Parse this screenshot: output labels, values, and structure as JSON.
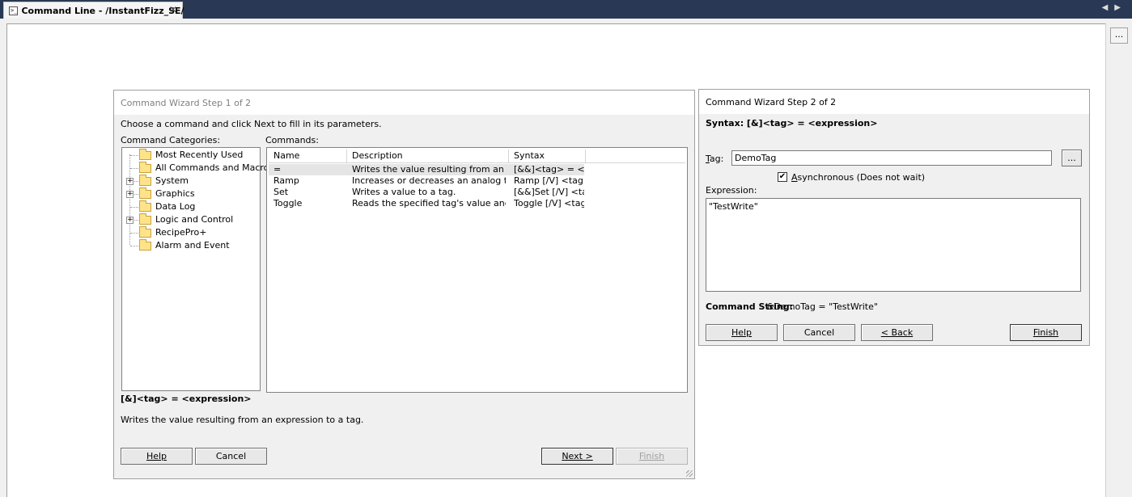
{
  "tab": {
    "title": "Command Line - /InstantFizz_SE/",
    "close": "✕"
  },
  "nav": {
    "prev": "◀",
    "next": "▶"
  },
  "side_button": {
    "label": "..."
  },
  "wizard1": {
    "title": "Command Wizard Step 1 of 2",
    "instruction": "Choose a command and click Next to fill in its parameters.",
    "categories_label": "Command Categories:",
    "commands_label": "Commands:",
    "categories": [
      {
        "label": "Most Recently Used",
        "expandable": false
      },
      {
        "label": "All Commands and Macros",
        "expandable": false
      },
      {
        "label": "System",
        "expandable": true
      },
      {
        "label": "Graphics",
        "expandable": true
      },
      {
        "label": "Data Log",
        "expandable": false
      },
      {
        "label": "Logic and Control",
        "expandable": true
      },
      {
        "label": "RecipePro+",
        "expandable": false
      },
      {
        "label": "Alarm and Event",
        "expandable": false
      }
    ],
    "columns": {
      "name": "Name",
      "description": "Description",
      "syntax": "Syntax"
    },
    "commands": [
      {
        "name": "=",
        "description": "Writes the value resulting from an exp...",
        "syntax": "[&&]<tag> = <ex...",
        "selected": true
      },
      {
        "name": "Ramp",
        "description": "Increases or decreases an analog tag...",
        "syntax": "Ramp [/V] <tag...",
        "selected": false
      },
      {
        "name": "Set",
        "description": "Writes a value to a tag.",
        "syntax": "[&&]Set [/V] <ta...",
        "selected": false
      },
      {
        "name": "Toggle",
        "description": "Reads the specified tag's value and ...",
        "syntax": "Toggle [/V] <tag>",
        "selected": false
      }
    ],
    "syntax_display": "[&]<tag> = <expression>",
    "description_display": "Writes the value resulting from an expression to a tag.",
    "buttons": {
      "help": "Help",
      "cancel": "Cancel",
      "next": "Next >",
      "finish": "Finish"
    }
  },
  "wizard2": {
    "title": "Command Wizard Step 2 of 2",
    "syntax": "Syntax: [&]<tag> = <expression>",
    "tag_label": "Tag:",
    "tag_value": "DemoTag",
    "browse": "...",
    "async_label": "Asynchronous (Does not wait)",
    "async_checked": true,
    "check_glyph": "✔",
    "expression_label": "Expression:",
    "expression_value": "\"TestWrite\"",
    "command_string_label": "Command String:",
    "command_string_value": "&DemoTag = \"TestWrite\"",
    "buttons": {
      "help": "Help",
      "cancel": "Cancel",
      "back": "< Back",
      "finish": "Finish"
    }
  }
}
